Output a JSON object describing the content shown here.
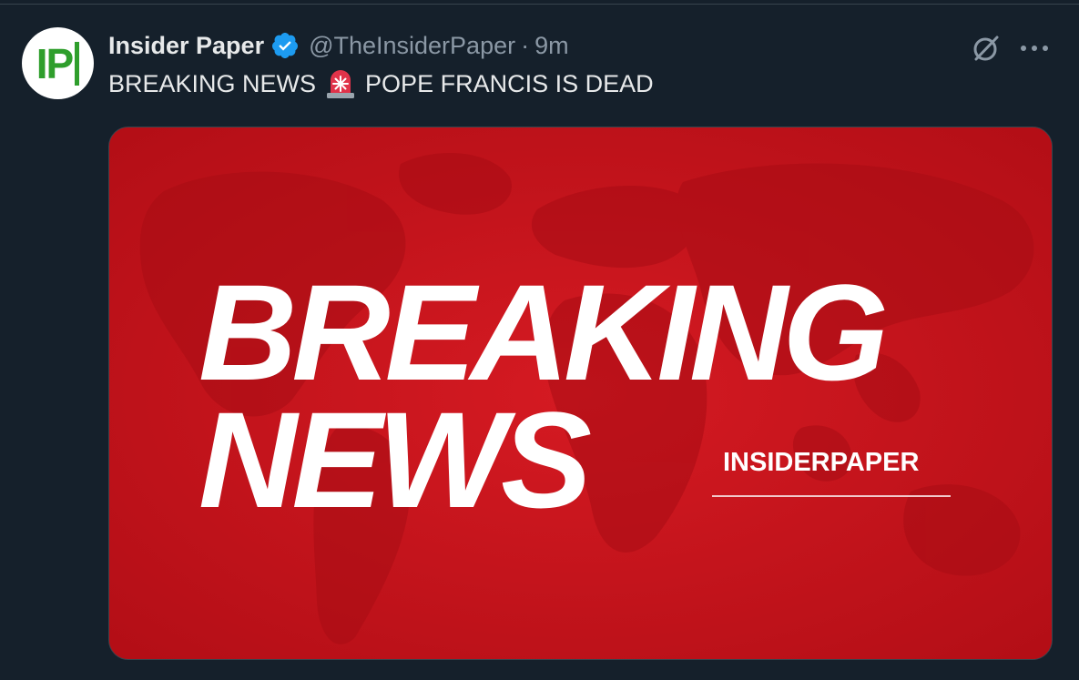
{
  "tweet": {
    "display_name": "Insider Paper",
    "handle": "@TheInsiderPaper",
    "separator": "·",
    "time": "9m",
    "text_before": "BREAKING NEWS",
    "text_after": "POPE FRANCIS IS DEAD",
    "siren_emoji": "siren-emoji",
    "avatar_logo": "IP"
  },
  "media": {
    "headline_line1": "BREAKING",
    "headline_line2": "NEWS",
    "brand": "INSIDERPAPER"
  },
  "icons": {
    "verified": "verified-badge-icon",
    "grok": "grok-icon",
    "more": "more-options-icon"
  },
  "colors": {
    "background": "#15202b",
    "text_primary": "#e7e9ea",
    "text_secondary": "#8b98a5",
    "verified_blue": "#1d9bf0",
    "media_red": "#c8121a",
    "avatar_green": "#2f9e2c"
  }
}
